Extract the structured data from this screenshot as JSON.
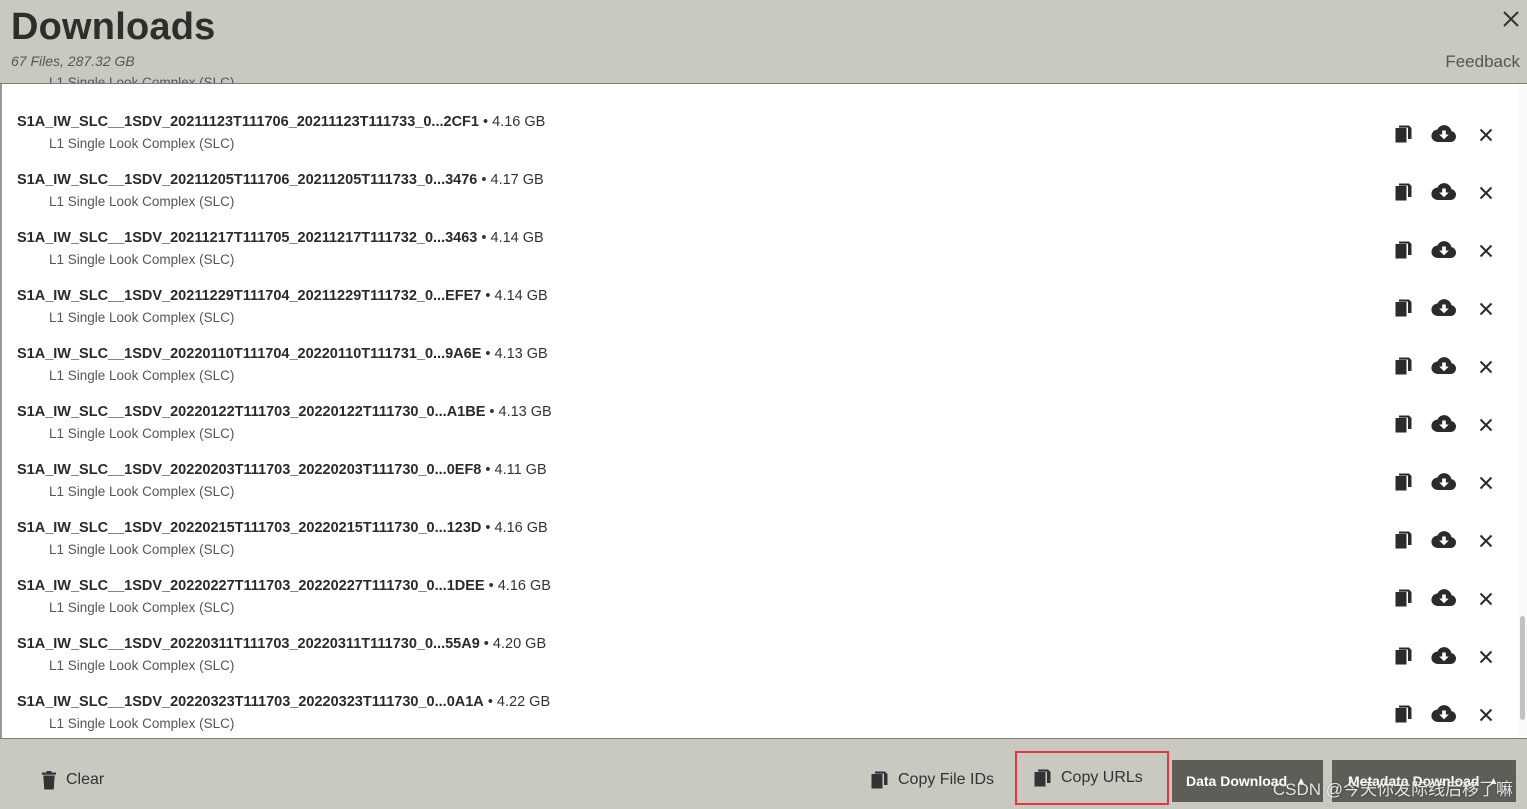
{
  "header": {
    "title": "Downloads",
    "subtitle": "67 Files, 287.32 GB",
    "feedback_label": "Feedback",
    "close_icon": "close-icon"
  },
  "list": {
    "clipped_top_label": "L1 Single Look Complex (SLC)",
    "items": [
      {
        "name": "S1A_IW_SLC__1SDV_20211123T111706_20211123T111733_0...2CF1",
        "size": " • 4.16 GB",
        "type": "L1 Single Look Complex (SLC)"
      },
      {
        "name": "S1A_IW_SLC__1SDV_20211205T111706_20211205T111733_0...3476",
        "size": " • 4.17 GB",
        "type": "L1 Single Look Complex (SLC)"
      },
      {
        "name": "S1A_IW_SLC__1SDV_20211217T111705_20211217T111732_0...3463",
        "size": " • 4.14 GB",
        "type": "L1 Single Look Complex (SLC)"
      },
      {
        "name": "S1A_IW_SLC__1SDV_20211229T111704_20211229T111732_0...EFE7",
        "size": " • 4.14 GB",
        "type": "L1 Single Look Complex (SLC)"
      },
      {
        "name": "S1A_IW_SLC__1SDV_20220110T111704_20220110T111731_0...9A6E",
        "size": " • 4.13 GB",
        "type": "L1 Single Look Complex (SLC)"
      },
      {
        "name": "S1A_IW_SLC__1SDV_20220122T111703_20220122T111730_0...A1BE",
        "size": " • 4.13 GB",
        "type": "L1 Single Look Complex (SLC)"
      },
      {
        "name": "S1A_IW_SLC__1SDV_20220203T111703_20220203T111730_0...0EF8",
        "size": " • 4.11 GB",
        "type": "L1 Single Look Complex (SLC)"
      },
      {
        "name": "S1A_IW_SLC__1SDV_20220215T111703_20220215T111730_0...123D",
        "size": " • 4.16 GB",
        "type": "L1 Single Look Complex (SLC)"
      },
      {
        "name": "S1A_IW_SLC__1SDV_20220227T111703_20220227T111730_0...1DEE",
        "size": " • 4.16 GB",
        "type": "L1 Single Look Complex (SLC)"
      },
      {
        "name": "S1A_IW_SLC__1SDV_20220311T111703_20220311T111730_0...55A9",
        "size": " • 4.20 GB",
        "type": "L1 Single Look Complex (SLC)"
      },
      {
        "name": "S1A_IW_SLC__1SDV_20220323T111703_20220323T111730_0...0A1A",
        "size": " • 4.22 GB",
        "type": "L1 Single Look Complex (SLC)"
      }
    ],
    "row_icons": [
      "copy-icon",
      "cloud-download-icon",
      "remove-icon"
    ]
  },
  "footer": {
    "clear_label": "Clear",
    "copy_file_ids_label": "Copy File IDs",
    "copy_urls_label": "Copy URLs",
    "data_download_label": "Data Download",
    "metadata_download_label": "Metadata Download",
    "highlight_color": "#e23a3a"
  },
  "watermark": "CSDN @今天你发际线后移了嘛",
  "colors": {
    "header_bg": "#c9c9c2",
    "footer_bg": "#c9c9c2",
    "dark_button_bg": "#5d5e57",
    "highlight": "#e23a3a"
  }
}
